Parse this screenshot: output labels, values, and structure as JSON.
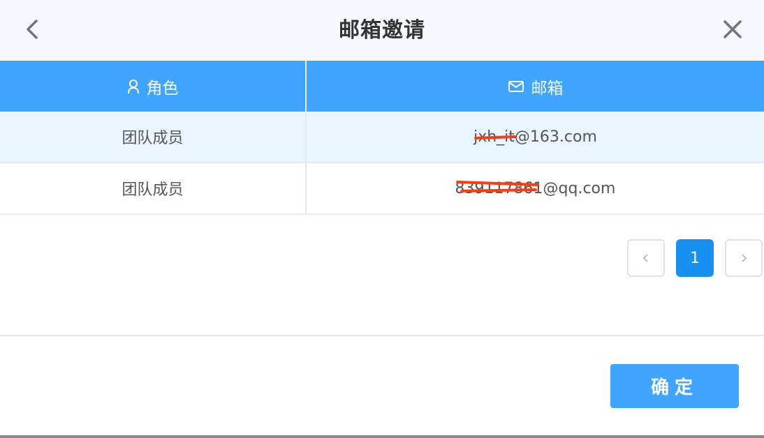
{
  "dialog": {
    "title": "邮箱邀请",
    "back_icon": "chevron-left-icon",
    "close_icon": "close-icon"
  },
  "table": {
    "columns": [
      {
        "label": "角色",
        "icon": "user-icon"
      },
      {
        "label": "邮箱",
        "icon": "mail-icon"
      }
    ],
    "rows": [
      {
        "role": "团队成员",
        "email": "jxh_it@163.com",
        "highlighted": true,
        "email_redacted": true
      },
      {
        "role": "团队成员",
        "email": "839117861@qq.com",
        "highlighted": false,
        "email_redacted": true
      }
    ]
  },
  "pagination": {
    "prev_icon": "chevron-left-icon",
    "next_icon": "chevron-right-icon",
    "current_page": "1"
  },
  "footer": {
    "confirm_label": "确定"
  },
  "colors": {
    "header_bg": "#f6f9fe",
    "table_header_bg": "#40a5ff",
    "row_highlight": "#eaf6ff",
    "active_page": "#1890f0",
    "redaction": "#ff3b12"
  }
}
